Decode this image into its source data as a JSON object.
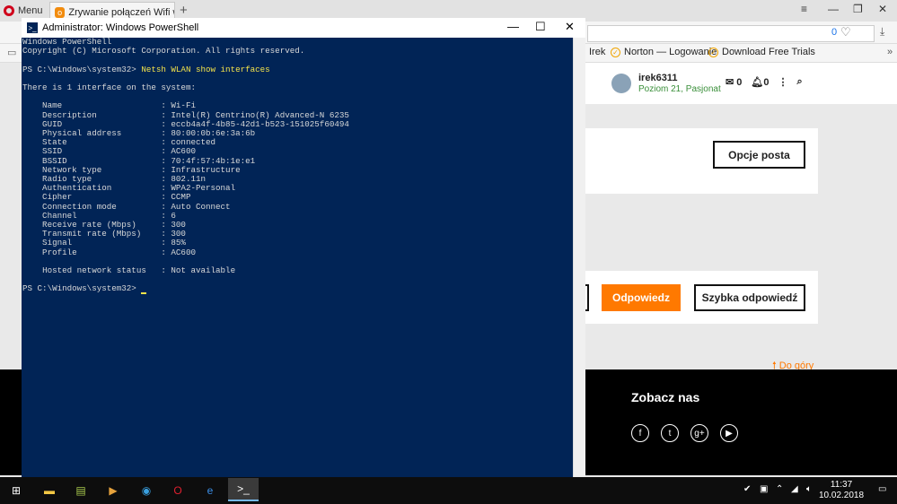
{
  "browser": {
    "menu_label": "Menu",
    "active_tab_title": "Zrywanie połączeń Wifi w",
    "new_tab": "+",
    "address_badge": "0",
    "bookmarks": [
      {
        "label": "Irek"
      },
      {
        "label": "Norton — Logowanie"
      },
      {
        "label": "Download Free Trials"
      }
    ]
  },
  "site": {
    "username": "irek6311",
    "user_level": "Poziom 21, Pasjonat",
    "mail_count": "0",
    "notif_count": "0",
    "options_button": "Opcje posta",
    "reply_button": "Odpowiedz",
    "quick_reply_button": "Szybka odpowiedź",
    "to_top": "Do góry",
    "footer_title": "Zobacz nas",
    "social": [
      "f",
      "t",
      "g+",
      "▶"
    ]
  },
  "powershell": {
    "title": "Administrator: Windows PowerShell",
    "header_line1": "Windows PowerShell",
    "header_line2": "Copyright (C) Microsoft Corporation. All rights reserved.",
    "prompt": "PS C:\\Windows\\system32>",
    "command": "Netsh WLAN show interfaces",
    "interfaces_line": "There is 1 interface on the system:",
    "fields": [
      [
        "Name",
        "Wi-Fi"
      ],
      [
        "Description",
        "Intel(R) Centrino(R) Advanced-N 6235"
      ],
      [
        "GUID",
        "eccb4a4f-4b85-42d1-b523-151025f60494"
      ],
      [
        "Physical address",
        "80:00:0b:6e:3a:6b"
      ],
      [
        "State",
        "connected"
      ],
      [
        "SSID",
        "AC600"
      ],
      [
        "BSSID",
        "70:4f:57:4b:1e:e1"
      ],
      [
        "Network type",
        "Infrastructure"
      ],
      [
        "Radio type",
        "802.11n"
      ],
      [
        "Authentication",
        "WPA2-Personal"
      ],
      [
        "Cipher",
        "CCMP"
      ],
      [
        "Connection mode",
        "Auto Connect"
      ],
      [
        "Channel",
        "6"
      ],
      [
        "Receive rate (Mbps)",
        "300"
      ],
      [
        "Transmit rate (Mbps)",
        "300"
      ],
      [
        "Signal",
        "85%"
      ],
      [
        "Profile",
        "AC600"
      ]
    ],
    "hosted_label": "Hosted network status",
    "hosted_value": "Not available"
  },
  "taskbar": {
    "time": "11:37",
    "date": "10.02.2018"
  }
}
